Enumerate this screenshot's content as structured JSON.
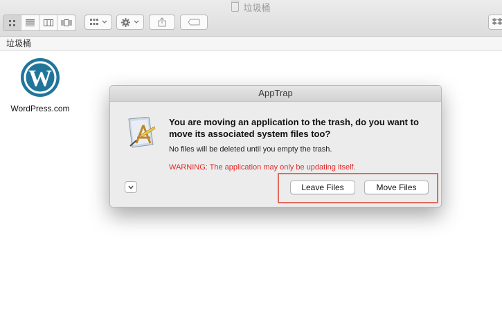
{
  "window": {
    "title": "垃圾桶",
    "path": "垃圾桶"
  },
  "toolbar": {
    "view_buttons": [
      "icon-view-icon",
      "list-view-icon",
      "column-view-icon",
      "cover-flow-icon"
    ],
    "arrange_icon": "arrange-icon",
    "action_icon": "gear-icon",
    "share_icon": "share-icon",
    "tag_icon": "tag-icon",
    "dropbox_icon": "dropbox-icon"
  },
  "files": [
    {
      "name": "WordPress.com",
      "icon": "wordpress-icon"
    }
  ],
  "dialog": {
    "title": "AppTrap",
    "heading": "You are moving an application to the trash, do you want to move its associated system files too?",
    "body": "No files will be deleted until you empty the trash.",
    "warning": "WARNING: The application may only be updating itself.",
    "leave_button": "Leave Files",
    "move_button": "Move Files"
  },
  "colors": {
    "wordpress": "#21759b",
    "warning": "#e02a2a",
    "highlight": "#e06a5a"
  }
}
